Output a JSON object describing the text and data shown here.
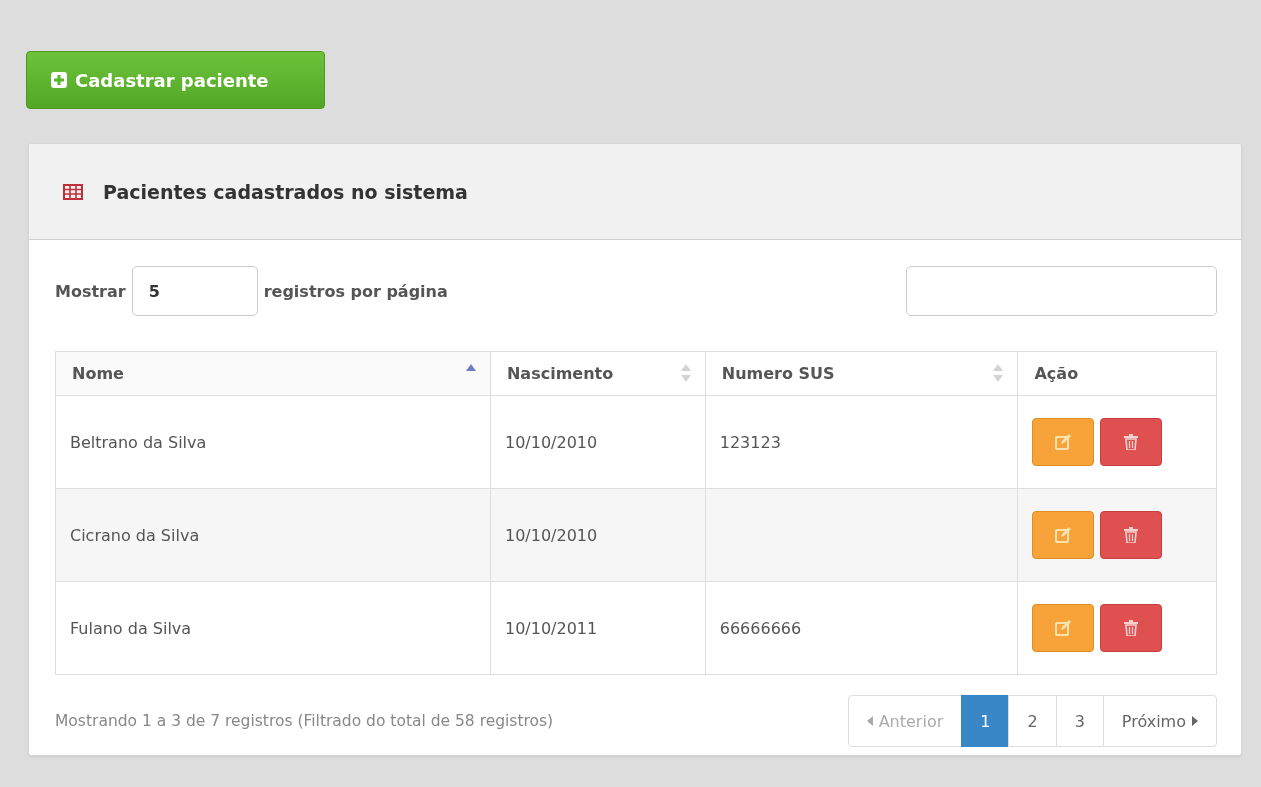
{
  "add_button": {
    "label": "Cadastrar paciente"
  },
  "panel": {
    "title": "Pacientes cadastrados no sistema"
  },
  "length_control": {
    "prefix": "Mostrar",
    "value": "5",
    "suffix": "registros por página"
  },
  "table": {
    "columns": [
      {
        "label": "Nome",
        "sortable": true,
        "sorted": true
      },
      {
        "label": "Nascimento",
        "sortable": true,
        "sorted": false
      },
      {
        "label": "Numero SUS",
        "sortable": true,
        "sorted": false
      },
      {
        "label": "Ação",
        "sortable": false
      }
    ],
    "rows": [
      {
        "cells": [
          "Beltrano da Silva",
          "10/10/2010",
          "123123"
        ]
      },
      {
        "cells": [
          "Cicrano da Silva",
          "10/10/2010",
          ""
        ]
      },
      {
        "cells": [
          "Fulano da Silva",
          "10/10/2011",
          "66666666"
        ]
      }
    ]
  },
  "info": "Mostrando 1 a 3 de 7 registros (Filtrado do total de 58 registros)",
  "pagination": {
    "previous": {
      "label": "Anterior",
      "disabled": true
    },
    "pages": [
      {
        "label": "1",
        "selected": true
      },
      {
        "label": "2",
        "selected": false
      },
      {
        "label": "3",
        "selected": false
      }
    ],
    "next": {
      "label": "Próximo",
      "disabled": false
    }
  }
}
